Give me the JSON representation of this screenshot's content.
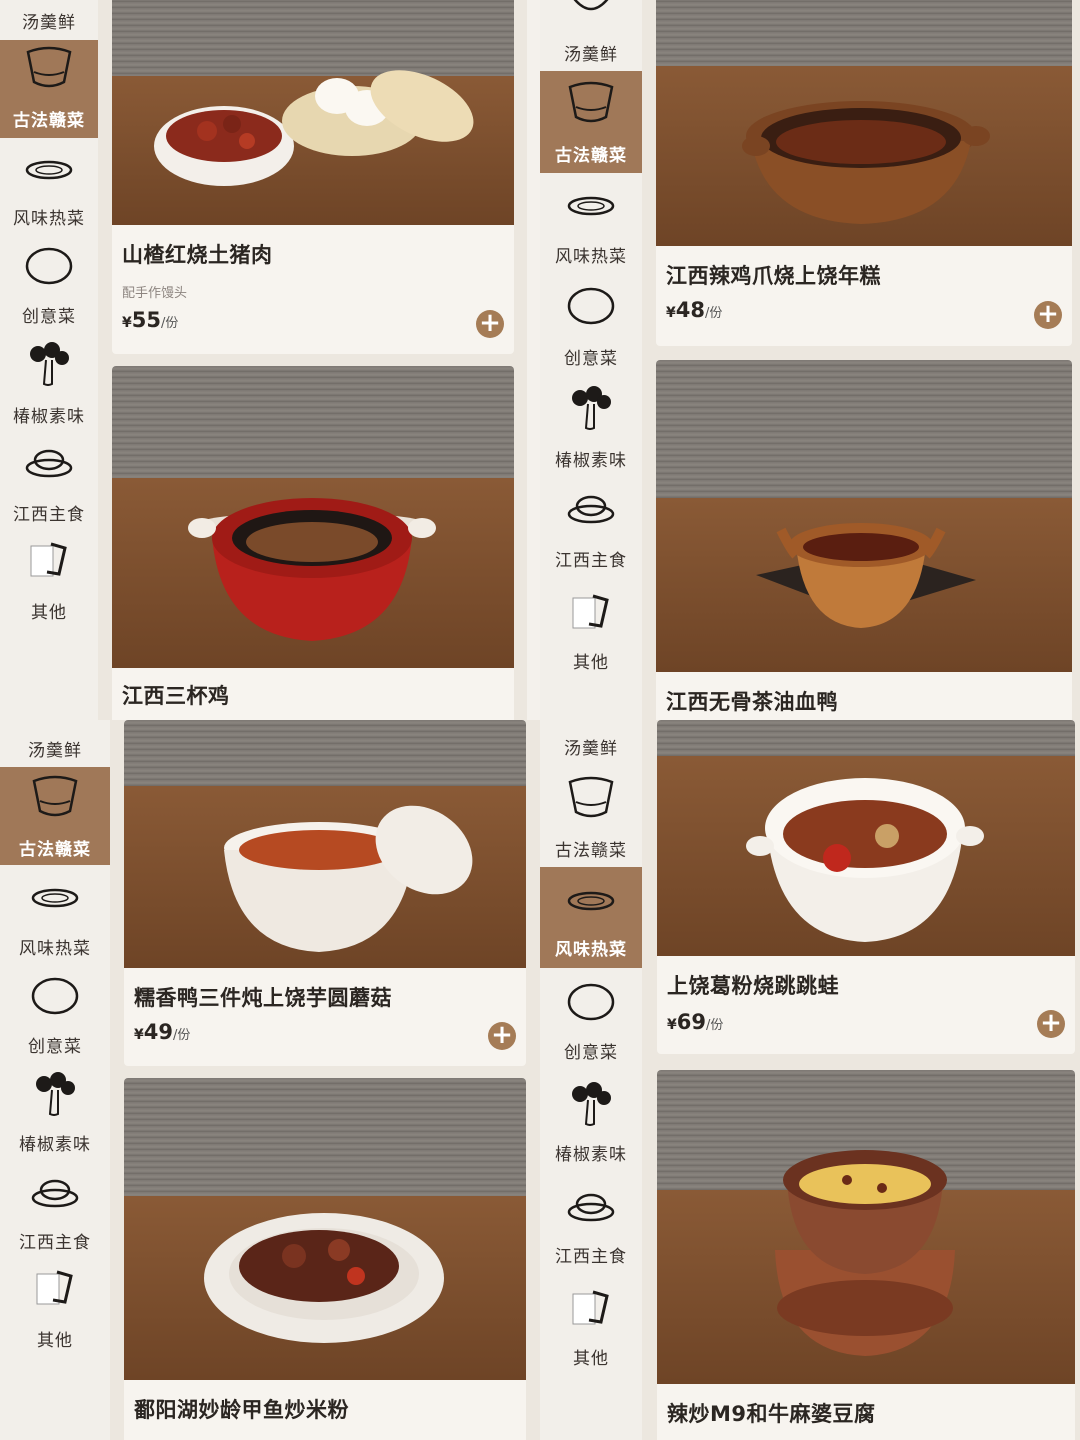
{
  "categories": [
    "汤羹鲜",
    "古法赣菜",
    "风味热菜",
    "创意菜",
    "椿椒素味",
    "江西主食",
    "其他"
  ],
  "category_icons": [
    "bowl-icon",
    "clay-pot-icon",
    "plate-icon",
    "round-plate-icon",
    "vegetable-icon",
    "rice-bowl-icon",
    "menu-card-icon"
  ],
  "accent_color": "#a07858",
  "add_button_color": "#a57c56",
  "panels": [
    {
      "active_category": "古法赣菜",
      "dishes": [
        {
          "name": "山楂红烧土猪肉",
          "note": "配手作馒头",
          "currency": "¥",
          "price": "55",
          "unit": "/份"
        },
        {
          "name": "江西三杯鸡"
        }
      ]
    },
    {
      "active_category": "古法赣菜",
      "dishes": [
        {
          "name": "江西辣鸡爪烧上饶年糕",
          "currency": "¥",
          "price": "48",
          "unit": "/份"
        },
        {
          "name": "江西无骨茶油血鸭"
        }
      ]
    },
    {
      "active_category": "古法赣菜",
      "dishes": [
        {
          "name": "糯香鸭三件炖上饶芋圆蘑菇",
          "currency": "¥",
          "price": "49",
          "unit": "/份"
        },
        {
          "name": "鄱阳湖妙龄甲鱼炒米粉"
        }
      ]
    },
    {
      "active_category": "风味热菜",
      "dishes": [
        {
          "name": "上饶葛粉烧跳跳蛙",
          "currency": "¥",
          "price": "69",
          "unit": "/份"
        },
        {
          "name": "辣炒M9和牛麻婆豆腐"
        }
      ]
    }
  ]
}
